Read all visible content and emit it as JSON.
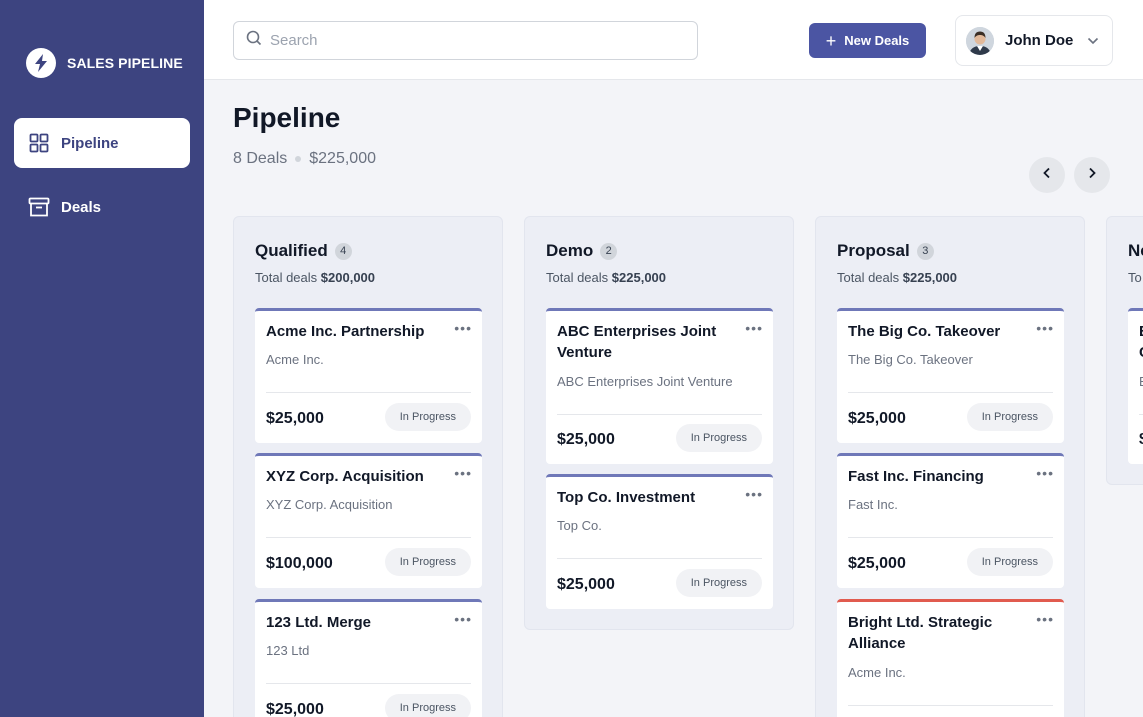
{
  "sidebar": {
    "brand": "SALES PIPELINE",
    "items": [
      {
        "label": "Pipeline",
        "icon": "grid-icon",
        "active": true
      },
      {
        "label": "Deals",
        "icon": "archive-icon",
        "active": false
      }
    ]
  },
  "header": {
    "search_placeholder": "Search",
    "new_button_label": "New Deals",
    "user_name": "John Doe"
  },
  "page": {
    "title": "Pipeline",
    "deals_count": "8 Deals",
    "total_value": "$225,000"
  },
  "columns": [
    {
      "title": "Qualified",
      "count": "4",
      "total_label": "Total deals",
      "total_value": "$200,000",
      "cards": [
        {
          "title": "Acme Inc. Partnership",
          "company": "Acme Inc.",
          "amount": "$25,000",
          "status": "In Progress",
          "accent": "#6f78b8"
        },
        {
          "title": "XYZ Corp. Acquisition",
          "company": "XYZ Corp. Acquisition",
          "amount": "$100,000",
          "status": "In Progress",
          "accent": "#6f78b8"
        },
        {
          "title": "123 Ltd. Merge",
          "company": "123 Ltd",
          "amount": "$25,000",
          "status": "In Progress",
          "accent": "#6f78b8"
        }
      ]
    },
    {
      "title": "Demo",
      "count": "2",
      "total_label": "Total deals",
      "total_value": "$225,000",
      "cards": [
        {
          "title": "ABC Enterprises Joint Venture",
          "company": "ABC Enterprises Joint Venture",
          "amount": "$25,000",
          "status": "In Progress",
          "accent": "#6f78b8"
        },
        {
          "title": "Top Co. Investment",
          "company": "Top Co.",
          "amount": "$25,000",
          "status": "In Progress",
          "accent": "#6f78b8"
        }
      ]
    },
    {
      "title": "Proposal",
      "count": "3",
      "total_label": "Total deals",
      "total_value": "$225,000",
      "cards": [
        {
          "title": "The Big Co. Takeover",
          "company": "The Big Co. Takeover",
          "amount": "$25,000",
          "status": "In Progress",
          "accent": "#6f78b8"
        },
        {
          "title": "Fast Inc. Financing",
          "company": "Fast Inc.",
          "amount": "$25,000",
          "status": "In Progress",
          "accent": "#6f78b8"
        },
        {
          "title": "Bright Ltd. Strategic Alliance",
          "company": "Acme Inc.",
          "amount": "",
          "status": "",
          "accent": "#e15b4f"
        }
      ]
    },
    {
      "title": "Ne",
      "total_label": "To",
      "cards": [
        {
          "title": "E\nC",
          "company": "E",
          "amount": "$"
        }
      ]
    }
  ],
  "colors": {
    "sidebar_bg": "#3d4480",
    "accent": "#4b55a3",
    "card_border": "#6f78b8",
    "alert_border": "#e15b4f"
  }
}
